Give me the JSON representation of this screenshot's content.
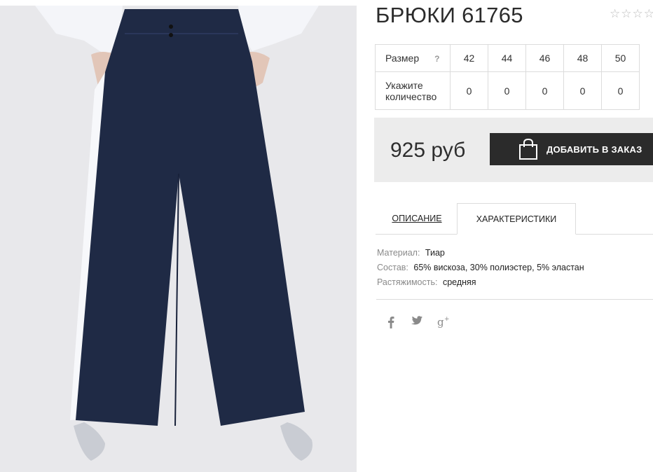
{
  "product": {
    "title": "БРЮКИ 61765",
    "rating_stars": "☆☆☆☆☆",
    "image_alt": "Брюки 61765"
  },
  "sizes": {
    "row_label": "Размер",
    "help_mark": "?",
    "values": [
      "42",
      "44",
      "46",
      "48",
      "50"
    ],
    "qty_label_line1": "Укажите",
    "qty_label_line2": "количество",
    "quantities": [
      "0",
      "0",
      "0",
      "0",
      "0"
    ]
  },
  "purchase": {
    "price": "925 руб",
    "add_button": "ДОБАВИТЬ В ЗАКАЗ",
    "button_color": "#2b2b2b"
  },
  "tabs": {
    "description": "ОПИСАНИЕ",
    "characteristics": "ХАРАКТЕРИСТИКИ",
    "active": "characteristics"
  },
  "specs": [
    {
      "key": "Материал:",
      "value": "Тиар"
    },
    {
      "key": "Состав:",
      "value": "65% вискоза, 30% полиэстер, 5% эластан"
    },
    {
      "key": "Растяжимость:",
      "value": "средняя"
    }
  ],
  "social": {
    "facebook": "f",
    "twitter": "🐦",
    "google_plus": "g+"
  }
}
